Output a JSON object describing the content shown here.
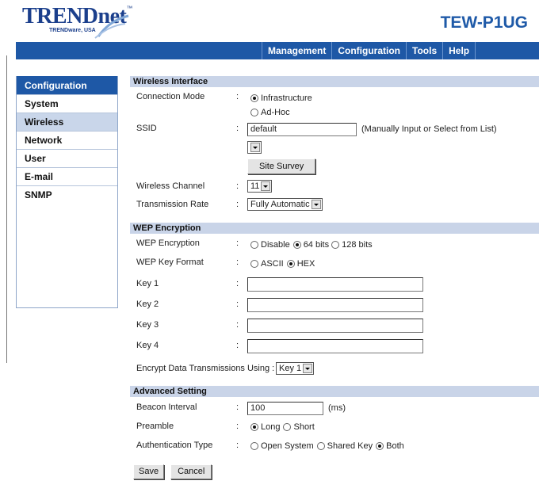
{
  "header": {
    "brand": "TRENDnet",
    "tagline": "TRENDware, USA",
    "model": "TEW-P1UG"
  },
  "nav": {
    "items": [
      "Management",
      "Configuration",
      "Tools",
      "Help"
    ]
  },
  "sidebar": {
    "title": "Configuration",
    "items": [
      "System",
      "Wireless",
      "Network",
      "User",
      "E-mail",
      "SNMP"
    ],
    "active": "Wireless"
  },
  "wireless": {
    "section_title": "Wireless Interface",
    "connection_mode_label": "Connection Mode",
    "mode_infrastructure": "Infrastructure",
    "mode_adhoc": "Ad-Hoc",
    "ssid_label": "SSID",
    "ssid_value": "default",
    "ssid_hint": "(Manually Input or Select from List)",
    "ssid_list_value": "",
    "site_survey_button": "Site Survey",
    "channel_label": "Wireless Channel",
    "channel_value": "11",
    "rate_label": "Transmission Rate",
    "rate_value": "Fully Automatic"
  },
  "wep": {
    "section_title": "WEP Encryption",
    "encryption_label": "WEP Encryption",
    "opt_disable": "Disable",
    "opt_64": "64 bits",
    "opt_128": "128 bits",
    "key_format_label": "WEP Key Format",
    "opt_ascii": "ASCII",
    "opt_hex": "HEX",
    "key1_label": "Key 1",
    "key2_label": "Key 2",
    "key3_label": "Key 3",
    "key4_label": "Key 4",
    "key1_value": "",
    "key2_value": "",
    "key3_value": "",
    "key4_value": "",
    "encrypt_using_label": "Encrypt Data Transmissions Using :",
    "encrypt_using_value": "Key 1"
  },
  "advanced": {
    "section_title": "Advanced Setting",
    "beacon_label": "Beacon Interval",
    "beacon_value": "100",
    "beacon_unit": "(ms)",
    "preamble_label": "Preamble",
    "opt_long": "Long",
    "opt_short": "Short",
    "auth_label": "Authentication Type",
    "opt_open": "Open System",
    "opt_shared": "Shared Key",
    "opt_both": "Both"
  },
  "actions": {
    "save": "Save",
    "cancel": "Cancel"
  },
  "colon": ":",
  "colors": {
    "nav_bar": "#1e58a6",
    "section_header": "#c9d4e8",
    "sidebar_active": "#c9d6ea",
    "brand": "#1b3f8c"
  }
}
